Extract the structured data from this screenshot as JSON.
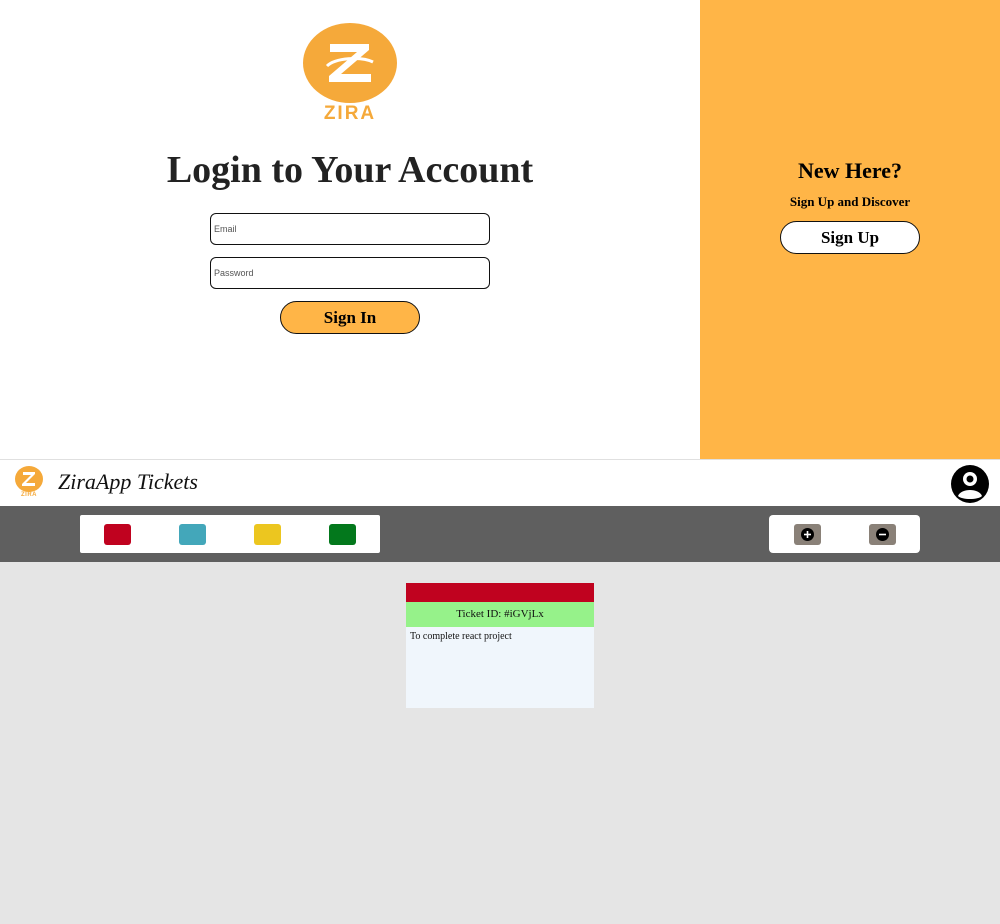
{
  "login": {
    "logo_text": "ZIRA",
    "title": "Login to Your Account",
    "email_placeholder": "Email",
    "password_placeholder": "Password",
    "signin_label": "Sign In"
  },
  "signup_panel": {
    "heading": "New Here?",
    "subheading": "Sign Up and Discover",
    "signup_label": "Sign Up"
  },
  "app": {
    "logo_text": "ZIRA",
    "title": "ZiraApp Tickets",
    "avatar_icon": "user-avatar-icon"
  },
  "toolbar": {
    "colors": [
      {
        "name": "red",
        "hex": "#c0021f"
      },
      {
        "name": "teal",
        "hex": "#43a7ba"
      },
      {
        "name": "yellow",
        "hex": "#ecc61f"
      },
      {
        "name": "green",
        "hex": "#03781c"
      }
    ],
    "actions": [
      {
        "icon": "plus-circle-icon"
      },
      {
        "icon": "minus-circle-icon"
      }
    ]
  },
  "tickets": [
    {
      "color": "#c0021f",
      "id_label": "Ticket ID: #iGVjLx",
      "task": "To complete react project"
    }
  ],
  "colors": {
    "brand_orange": "#ffb547",
    "toolbar_gray": "#5f5f5f",
    "ticket_id_green": "#96f28a"
  }
}
